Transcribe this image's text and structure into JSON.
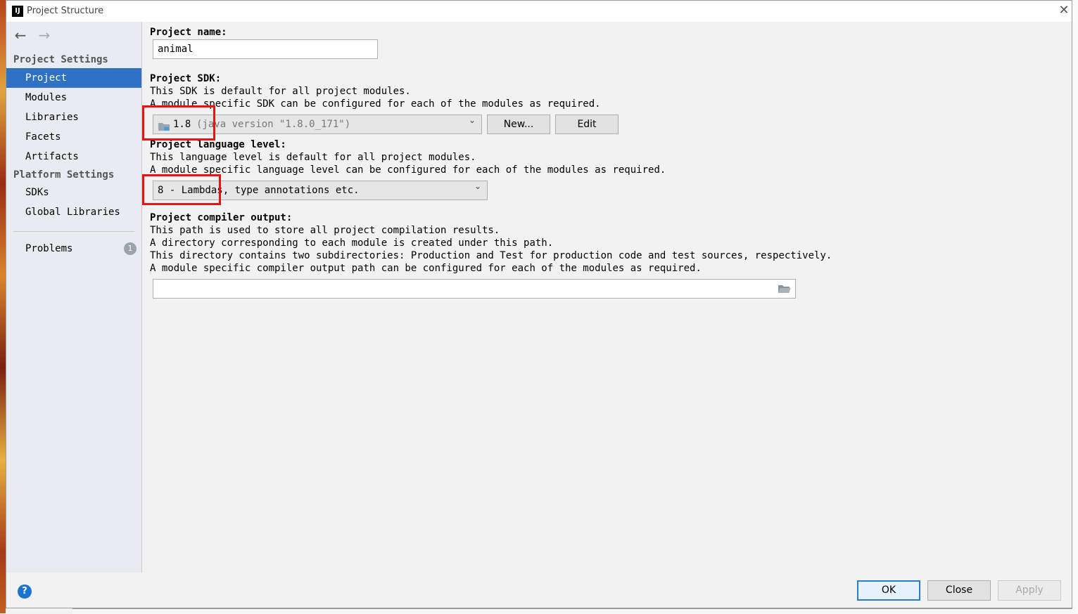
{
  "window": {
    "title": "Project Structure",
    "app_icon_text": "IJ",
    "close_glyph": "✕"
  },
  "nav": {
    "back_glyph": "←",
    "forward_glyph": "→"
  },
  "sidebar": {
    "project_settings_header": "Project Settings",
    "platform_settings_header": "Platform Settings",
    "project_items": [
      "Project",
      "Modules",
      "Libraries",
      "Facets",
      "Artifacts"
    ],
    "platform_items": [
      "SDKs",
      "Global Libraries"
    ],
    "selected": "Project",
    "problems_label": "Problems",
    "problems_count": "1"
  },
  "project_name": {
    "label": "Project name:",
    "value": "animal"
  },
  "project_sdk": {
    "label": "Project SDK:",
    "desc_line1": "This SDK is default for all project modules.",
    "desc_line2": "A module specific SDK can be configured for each of the modules as required.",
    "selected_version": "1.8",
    "selected_detail": "(java version \"1.8.0_171\")",
    "new_button": "New...",
    "edit_button": "Edit"
  },
  "language_level": {
    "label": "Project language level:",
    "desc_line1": "This language level is default for all project modules.",
    "desc_line2": "A module specific language level can be configured for each of the modules as required.",
    "selected": "8 - Lambdas, type annotations etc."
  },
  "compiler_output": {
    "label": "Project compiler output:",
    "desc_line1": "This path is used to store all project compilation results.",
    "desc_line2": "A directory corresponding to each module is created under this path.",
    "desc_line3": "This directory contains two subdirectories: Production and Test for production code and test sources, respectively.",
    "desc_line4": "A module specific compiler output path can be configured for each of the modules as required.",
    "value": ""
  },
  "footer": {
    "help_glyph": "?",
    "ok_button": "OK",
    "close_button": "Close",
    "apply_button": "Apply"
  },
  "colors": {
    "selection": "#2f72c4",
    "highlight": "#ee1111",
    "primary_border": "#2d7bd0",
    "help_icon": "#1a73d0"
  }
}
